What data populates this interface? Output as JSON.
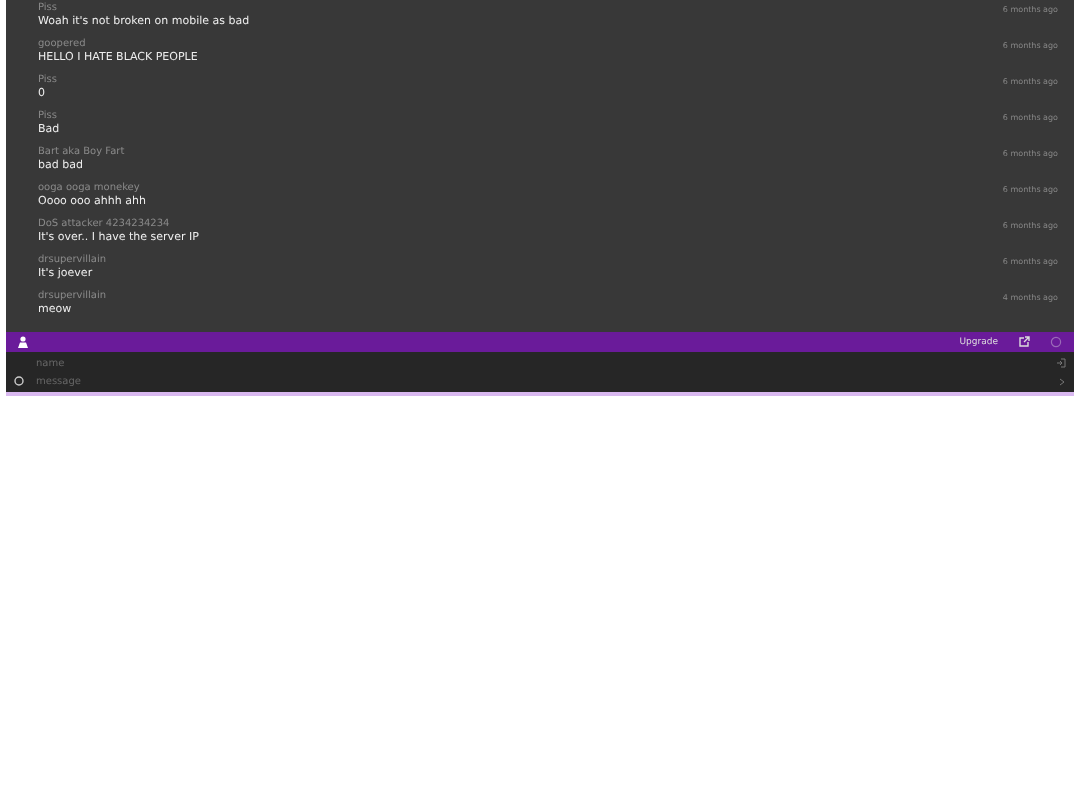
{
  "messages": [
    {
      "author": "Piss",
      "text": "Woah it's not broken on mobile as bad",
      "time": "6 months ago"
    },
    {
      "author": "goopered",
      "text": "HELLO I HATE BLACK PEOPLE",
      "time": "6 months ago"
    },
    {
      "author": "Piss",
      "text": "0",
      "time": "6 months ago"
    },
    {
      "author": "Piss",
      "text": "Bad",
      "time": "6 months ago"
    },
    {
      "author": "Bart aka Boy Fart",
      "text": "bad bad",
      "time": "6 months ago"
    },
    {
      "author": "ooga ooga monekey",
      "text": "Oooo ooo ahhh ahh",
      "time": "6 months ago"
    },
    {
      "author": "DoS attacker 4234234234",
      "text": "It's over.. I have the server IP",
      "time": "6 months ago"
    },
    {
      "author": "drsupervillain",
      "text": "It's joever",
      "time": "6 months ago"
    },
    {
      "author": "drsupervillain",
      "text": "meow",
      "time": "4 months ago"
    }
  ],
  "toolbar": {
    "upgrade": "Upgrade"
  },
  "composer": {
    "name_placeholder": "name",
    "message_placeholder": "message"
  }
}
